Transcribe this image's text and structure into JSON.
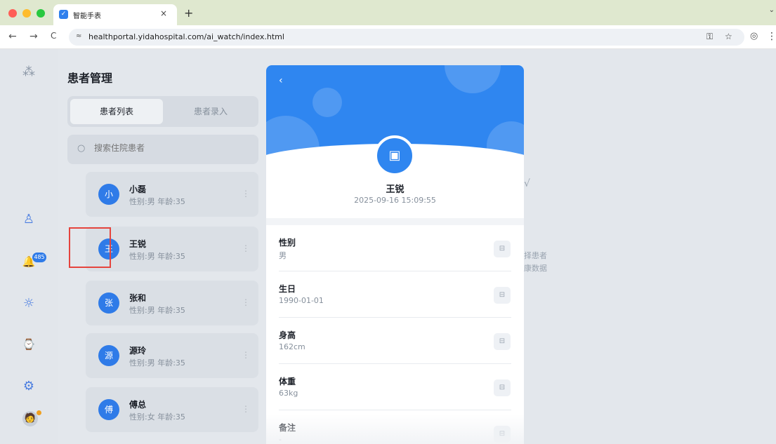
{
  "browser": {
    "tab_title": "智能手表",
    "tab_favicon": "✓",
    "url": "healthportal.yidahospital.com/ai_watch/index.html",
    "icons": {
      "close": "×",
      "new_tab": "+",
      "back": "←",
      "forward": "→",
      "reload": "C",
      "site_info": "≈",
      "password": "⚿",
      "star": "☆",
      "profile": "◎",
      "menu": "⋮",
      "dropdown": "⌄"
    }
  },
  "sidebar": {
    "logo_icon": "⁂",
    "items": [
      {
        "name": "patients",
        "icon": "♙"
      },
      {
        "name": "alerts",
        "icon": "🔔"
      },
      {
        "name": "theme",
        "icon": "☼"
      },
      {
        "name": "watch",
        "icon": "⌚"
      },
      {
        "name": "settings",
        "icon": "⚙"
      }
    ],
    "notification_count": "485",
    "user_avatar": "🧑"
  },
  "list": {
    "title": "患者管理",
    "tabs": [
      "患者列表",
      "患者录入"
    ],
    "search_placeholder": "搜索住院患者",
    "patients": [
      {
        "initial": "小",
        "name": "小磊",
        "meta": "性别:男 年龄:35"
      },
      {
        "initial": "王",
        "name": "王锐",
        "meta": "性别:男 年龄:35"
      },
      {
        "initial": "张",
        "name": "张和",
        "meta": "性别:男 年龄:35"
      },
      {
        "initial": "源",
        "name": "源玲",
        "meta": "性别:男 年龄:35"
      },
      {
        "initial": "傅",
        "name": "傅总",
        "meta": "性别:女 年龄:35"
      }
    ],
    "more_icon": "⋮"
  },
  "main": {
    "empty_icon": "√",
    "empty_line1": "择患者",
    "empty_line2": "康数据"
  },
  "detail": {
    "back_icon": "‹",
    "photo_icon": "▣",
    "name": "王锐",
    "timestamp": "2025-09-16 15:09:55",
    "edit_icon": "⊟",
    "fields": [
      {
        "label": "性别",
        "value": "男"
      },
      {
        "label": "生日",
        "value": "1990-01-01"
      },
      {
        "label": "身高",
        "value": "162cm"
      },
      {
        "label": "体重",
        "value": "63kg"
      },
      {
        "label": "备注",
        "value": "-"
      }
    ]
  },
  "colors": {
    "accent": "#2f86f0",
    "highlight": "#e5443d"
  }
}
